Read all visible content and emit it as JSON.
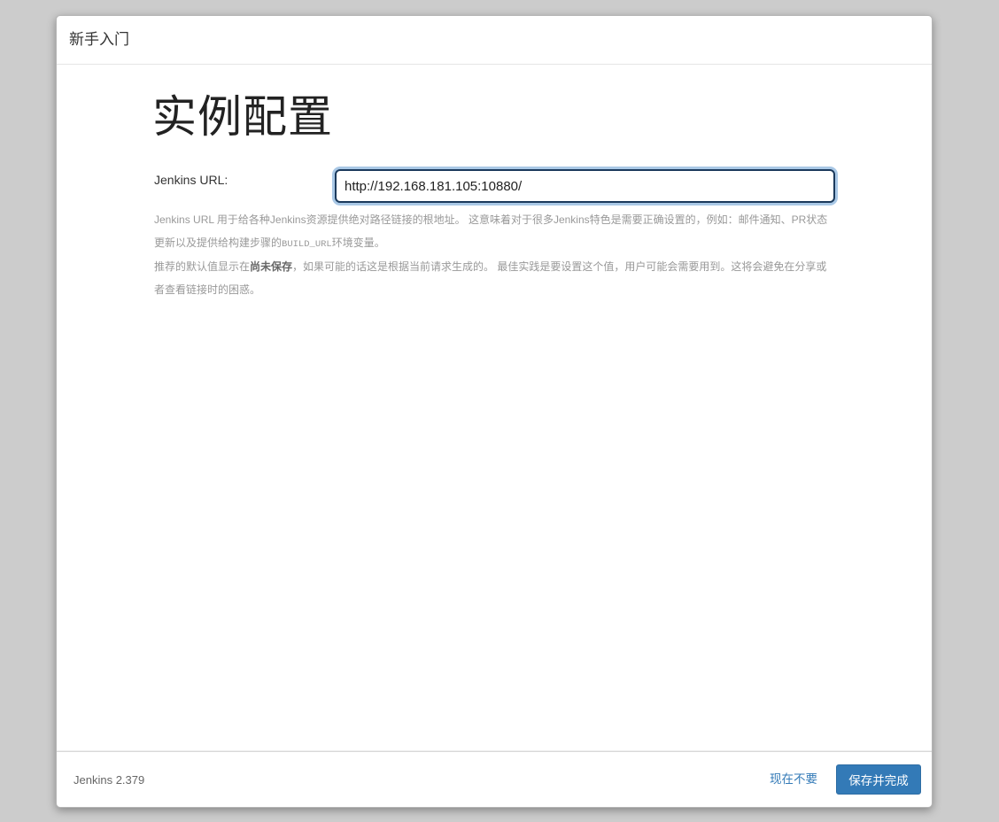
{
  "dialog": {
    "title": "新手入门"
  },
  "main": {
    "heading": "实例配置",
    "url_field": {
      "label": "Jenkins URL:",
      "value": "http://192.168.181.105:10880/"
    },
    "help": {
      "p1_text_a": "Jenkins URL 用于给各种Jenkins资源提供绝对路径链接的根地址。 这意味着对于很多Jenkins特色是需要正确设置的，例如：邮件通知、PR状态更新以及提供给构建步骤的",
      "p1_code": "BUILD_URL",
      "p1_text_b": "环境变量。",
      "p2_text_a": "推荐的默认值显示在",
      "p2_bold": "尚未保存",
      "p2_text_b": "，如果可能的话这是根据当前请求生成的。 最佳实践是要设置这个值，用户可能会需要用到。这将会避免在分享或者查看链接时的困惑。"
    }
  },
  "footer": {
    "version": "Jenkins 2.379",
    "skip_label": "现在不要",
    "save_label": "保存并完成"
  }
}
